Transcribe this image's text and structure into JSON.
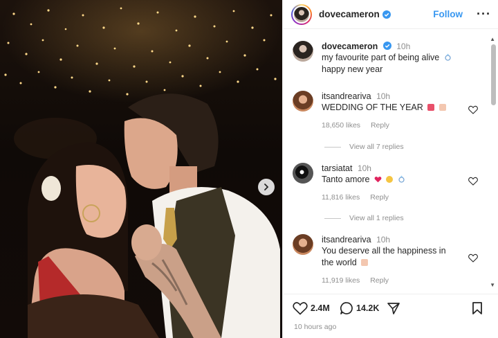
{
  "post": {
    "username": "dovecameron",
    "follow_label": "Follow",
    "caption_username": "dovecameron",
    "caption_time": "10h",
    "caption_line1": "my favourite part of being alive",
    "caption_line2": "happy new year"
  },
  "comments": [
    {
      "username": "itsandreariva",
      "time": "10h",
      "text": "WEDDING OF THE YEAR",
      "likes": "18,650 likes",
      "reply": "Reply",
      "view_replies": "View all 7 replies"
    },
    {
      "username": "tarsiatat",
      "time": "10h",
      "text": "Tanto amore",
      "likes": "11,816 likes",
      "reply": "Reply",
      "view_replies": "View all 1 replies"
    },
    {
      "username": "itsandreariva",
      "time": "10h",
      "text_line1": "You deserve all the happiness in",
      "text_line2": "the world",
      "likes": "11,919 likes",
      "reply": "Reply"
    }
  ],
  "actions": {
    "likes_count": "2.4M",
    "comments_count": "14.2K",
    "posted_ago": "10 hours ago"
  },
  "colors": {
    "accent": "#3897f0",
    "text": "#262626",
    "muted": "#8e8e8e"
  }
}
